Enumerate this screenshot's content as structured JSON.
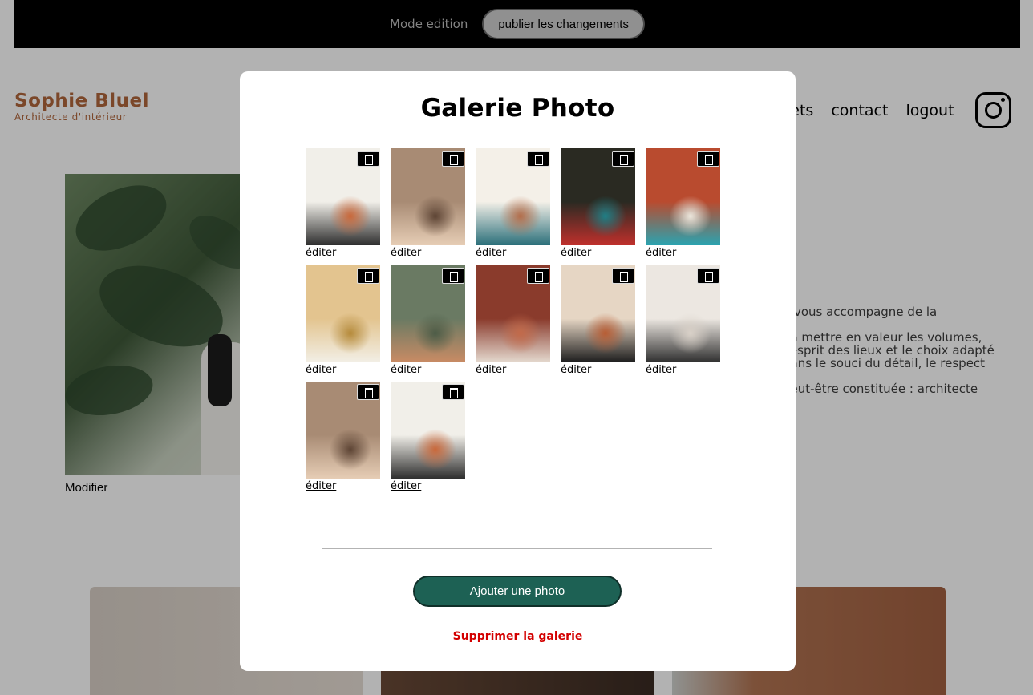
{
  "edit_bar": {
    "mode_label": "Mode edition",
    "publish_label": "publier les changements"
  },
  "header": {
    "logo_name": "Sophie Bluel",
    "logo_subtitle": "Architecte d'intérieur",
    "nav": [
      "jets",
      "contact",
      "logout"
    ],
    "instagram_icon": "instagram-icon"
  },
  "introduction": {
    "modify_label": "Modifier",
    "text_lines": [
      ". Je vous accompagne de la",
      "on à mettre en valeur les volumes,",
      "e l’esprit des lieux et le choix adapté",
      "é dans le souci du détail, le respect",
      "e peut-être constituée : architecte"
    ]
  },
  "modal": {
    "title": "Galerie Photo",
    "edit_label": "éditer",
    "add_photo_label": "Ajouter une photo",
    "delete_gallery_label": "Supprimer la galerie",
    "trash_icon": "trash-icon",
    "photos": [
      {
        "colors": [
          "#f1efe9",
          "#c9683a",
          "#2e2e2e"
        ]
      },
      {
        "colors": [
          "#a88b74",
          "#5d4434",
          "#e6cdb5"
        ]
      },
      {
        "colors": [
          "#f4f0e8",
          "#b36d4a",
          "#2b6f7a"
        ]
      },
      {
        "colors": [
          "#2a2a22",
          "#1f7f86",
          "#c0302c"
        ]
      },
      {
        "colors": [
          "#b94b2f",
          "#ece7dd",
          "#2aa3b0"
        ]
      },
      {
        "colors": [
          "#e3c48f",
          "#b58a3a",
          "#f2efe6"
        ]
      },
      {
        "colors": [
          "#6a7a63",
          "#4d5c47",
          "#c98b64"
        ]
      },
      {
        "colors": [
          "#8a3b2c",
          "#c26a4a",
          "#e4d9cf"
        ]
      },
      {
        "colors": [
          "#e6d6c4",
          "#b85d34",
          "#1d1d1d"
        ]
      },
      {
        "colors": [
          "#ece7e1",
          "#d9d1c8",
          "#2f2f2f"
        ]
      },
      {
        "colors": [
          "#a88b74",
          "#5d4434",
          "#e6cdb5"
        ]
      },
      {
        "colors": [
          "#f1efe9",
          "#c9683a",
          "#2e2e2e"
        ]
      }
    ]
  },
  "colors": {
    "brand": "#b1663c",
    "primary_button": "#1d6154",
    "danger": "#d30000"
  }
}
